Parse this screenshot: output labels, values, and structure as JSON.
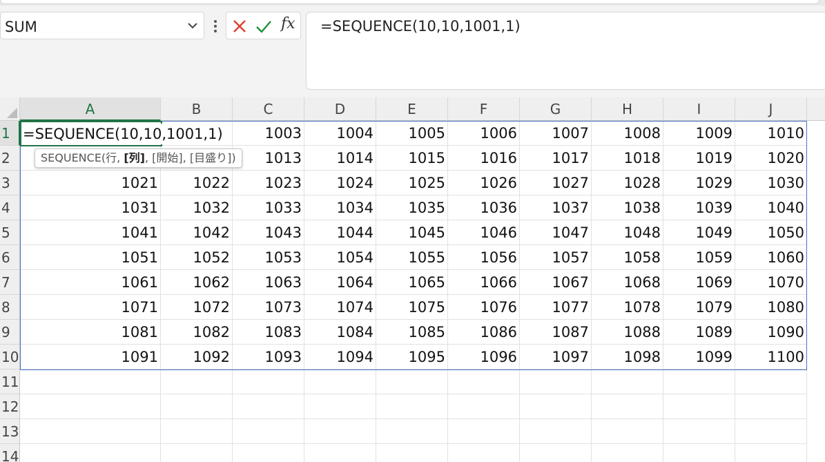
{
  "name_box": {
    "value": "SUM"
  },
  "formula_buttons": {
    "cancel_icon": "x-icon",
    "enter_icon": "check-icon",
    "function_label": "fx"
  },
  "formula_bar": {
    "value": "=SEQUENCE(10,10,1001,1)"
  },
  "columns": [
    "A",
    "B",
    "C",
    "D",
    "E",
    "F",
    "G",
    "H",
    "I",
    "J"
  ],
  "rows": [
    "1",
    "2",
    "3",
    "4",
    "5",
    "6",
    "7",
    "8",
    "9",
    "10",
    "11",
    "12",
    "13",
    "14"
  ],
  "editing": {
    "text": "=SEQUENCE(10,10,1001,1)",
    "cell": "A1"
  },
  "tooltip": {
    "prefix": "SEQUENCE(行, ",
    "bold": "[列]",
    "suffix": ", [開始], [目盛り])"
  },
  "cells": [
    [
      "",
      "",
      "1003",
      "1004",
      "1005",
      "1006",
      "1007",
      "1008",
      "1009",
      "1010"
    ],
    [
      "",
      "",
      "1013",
      "1014",
      "1015",
      "1016",
      "1017",
      "1018",
      "1019",
      "1020"
    ],
    [
      "1021",
      "1022",
      "1023",
      "1024",
      "1025",
      "1026",
      "1027",
      "1028",
      "1029",
      "1030"
    ],
    [
      "1031",
      "1032",
      "1033",
      "1034",
      "1035",
      "1036",
      "1037",
      "1038",
      "1039",
      "1040"
    ],
    [
      "1041",
      "1042",
      "1043",
      "1044",
      "1045",
      "1046",
      "1047",
      "1048",
      "1049",
      "1050"
    ],
    [
      "1051",
      "1052",
      "1053",
      "1054",
      "1055",
      "1056",
      "1057",
      "1058",
      "1059",
      "1060"
    ],
    [
      "1061",
      "1062",
      "1063",
      "1064",
      "1065",
      "1066",
      "1067",
      "1068",
      "1069",
      "1070"
    ],
    [
      "1071",
      "1072",
      "1073",
      "1074",
      "1075",
      "1076",
      "1077",
      "1078",
      "1079",
      "1080"
    ],
    [
      "1081",
      "1082",
      "1083",
      "1084",
      "1085",
      "1086",
      "1087",
      "1088",
      "1089",
      "1090"
    ],
    [
      "1091",
      "1092",
      "1093",
      "1094",
      "1095",
      "1096",
      "1097",
      "1098",
      "1099",
      "1100"
    ]
  ],
  "colors": {
    "selection_green": "#217346",
    "spill_range_blue": "#4472c4",
    "cancel_red": "#e03c31",
    "enter_green": "#1f8f3a"
  }
}
